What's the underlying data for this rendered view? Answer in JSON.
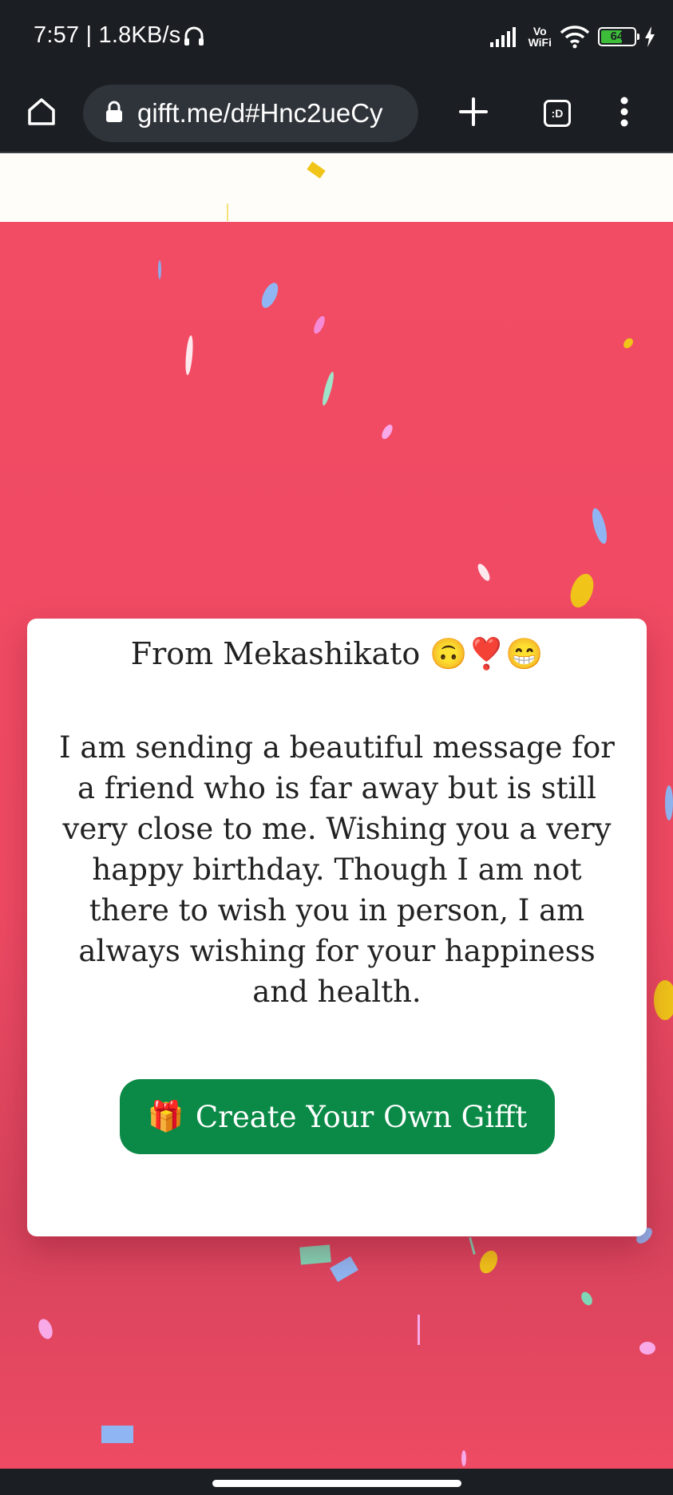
{
  "status_bar": {
    "time_speed": "7:57 | 1.8KB/s",
    "vo_label": "Vo",
    "wifi_label": "WiFi",
    "battery_level": "64"
  },
  "browser": {
    "url": "gifft.me/d#Hnc2ueCy",
    "tabs_label": ":D"
  },
  "card": {
    "from_text": "From Mekashikato 🙃❣️😁",
    "message": "I am sending a beautiful message for a friend who is far away but is still very close to me. Wishing you a very happy birthday. Though I am not there to wish you in person, I am always wishing for your happiness and health.",
    "cta_icon": "🎁",
    "cta_label": "Create Your Own Gifft"
  },
  "colors": {
    "page_background": "#ef4b63",
    "cta_background": "#0b8a47",
    "browser_chrome": "#1b1e22"
  }
}
